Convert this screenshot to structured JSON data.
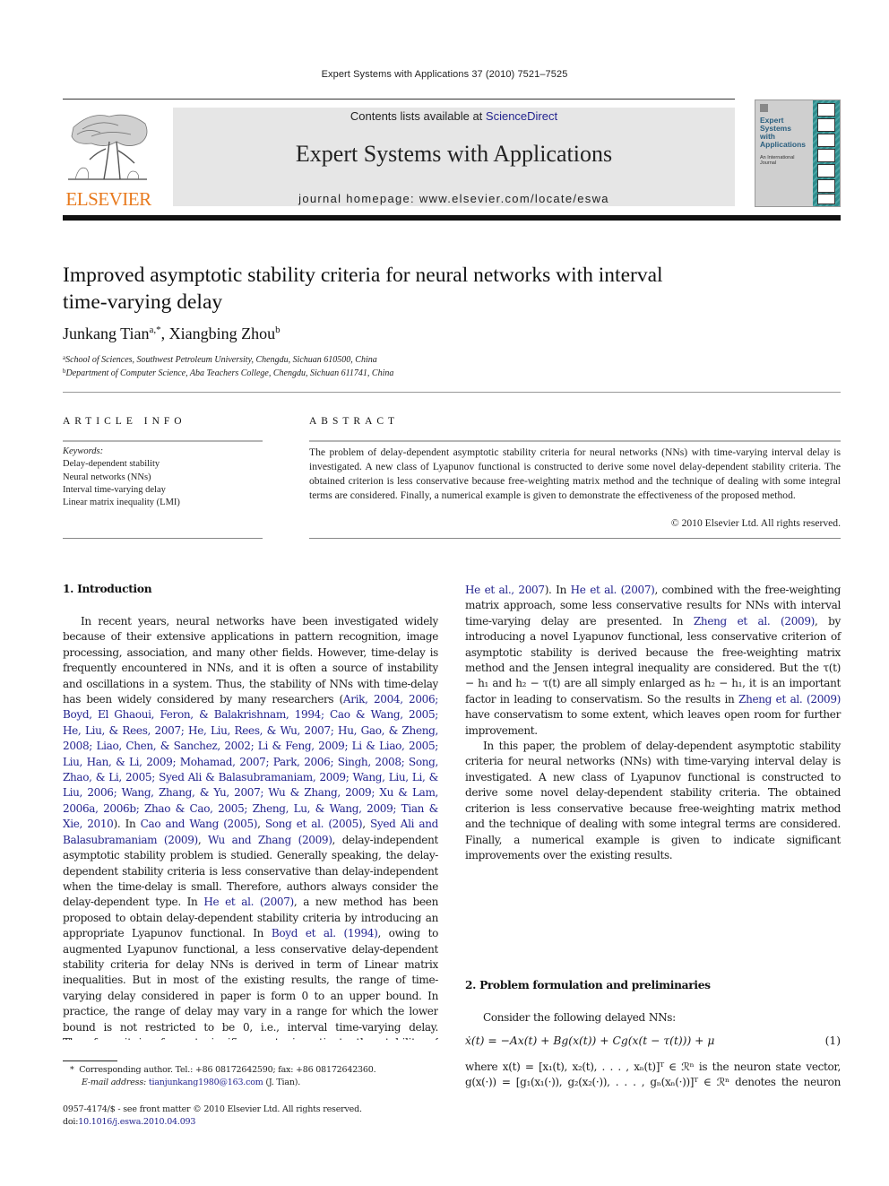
{
  "header": {
    "running_head": "Expert Systems with Applications 37 (2010) 7521–7525",
    "contents_prefix": "Contents lists available at ",
    "contents_link": "ScienceDirect",
    "journal_title": "Expert Systems with Applications",
    "homepage_prefix": "journal homepage: ",
    "homepage_url": "www.elsevier.com/locate/eswa",
    "publisher_name": "ELSEVIER",
    "cover_title_lines": [
      "Expert",
      "Systems",
      "with",
      "Applications"
    ],
    "cover_subtitle_lines": [
      "An International",
      "Journal"
    ]
  },
  "colors": {
    "link": "#24248f",
    "publisher_orange": "#e87a1e",
    "banner_gray": "#e6e6e6",
    "cover_teal": "#2f8b8b"
  },
  "article": {
    "title_line1": "Improved asymptotic stability criteria for neural networks with interval",
    "title_line2": "time-varying delay",
    "authors": [
      {
        "name": "Junkang Tian",
        "sup": "a,*"
      },
      {
        "name": "Xiangbing Zhou",
        "sup": "b"
      }
    ],
    "author_separator": ", ",
    "affiliations": [
      {
        "sup": "a",
        "text": "School of Sciences, Southwest Petroleum University, Chengdu, Sichuan 610500, China"
      },
      {
        "sup": "b",
        "text": "Department of Computer Science, Aba Teachers College, Chengdu, Sichuan 611741, China"
      }
    ]
  },
  "article_info": {
    "label": "ARTICLE INFO",
    "keywords_label": "Keywords:",
    "keywords": [
      "Delay-dependent stability",
      "Neural networks (NNs)",
      "Interval time-varying delay",
      "Linear matrix inequality (LMI)"
    ]
  },
  "abstract": {
    "label": "ABSTRACT",
    "text": "The problem of delay-dependent asymptotic stability criteria for neural networks (NNs) with time-varying interval delay is investigated. A new class of Lyapunov functional is constructed to derive some novel delay-dependent stability criteria. The obtained criterion is less conservative because free-weighting matrix method and the technique of dealing with some integral terms are considered. Finally, a numerical example is given to demonstrate the effectiveness of the proposed method.",
    "copyright": "© 2010 Elsevier Ltd. All rights reserved."
  },
  "section1": {
    "heading": "1. Introduction",
    "p1_a": "In recent years, neural networks have been investigated widely because of their extensive applications in pattern recognition, image processing, association, and many other fields. However, time-delay is frequently encountered in NNs, and it is often a source of instability and oscillations in a system. Thus, the stability of NNs with time-delay has been widely considered by many researchers (",
    "citations": "Arik, 2004, 2006; Boyd, El Ghaoui, Feron, & Balakrishnam, 1994; Cao & Wang, 2005; He, Liu, & Rees, 2007; He, Liu, Rees, & Wu, 2007; Hu, Gao, & Zheng, 2008; Liao, Chen, & Sanchez, 2002; Li & Feng, 2009; Li & Liao, 2005; Liu, Han, & Li, 2009; Mohamad, 2007; Park, 2006; Singh, 2008; Song, Zhao, & Li, 2005; Syed Ali & Balasubramaniam, 2009; Wang, Liu, Li, & Liu, 2006; Wang, Zhang, & Yu, 2007; Wu & Zhang, 2009; Xu & Lam, 2006a, 2006b; Zhao & Cao, 2005; Zheng, Lu, & Wang, 2009; Tian & Xie, 2010",
    "p1_b": "). In ",
    "cite_cao": "Cao and Wang (2005)",
    "comma1": ", ",
    "cite_song": "Song et al. (2005)",
    "comma2": ", ",
    "cite_syed": "Syed Ali and Balasubramaniam (2009)",
    "comma3": ", ",
    "cite_wu": "Wu and Zhang (2009)",
    "p1_c": ", delay-independent asymptotic stability problem is studied. Generally speaking, the delay-dependent stability criteria is less conservative than delay-independent when the time-delay is small. Therefore, authors always consider the delay-dependent type. In ",
    "cite_he1": "He et al. (2007)",
    "p1_d": ", a new method has been proposed to obtain delay-dependent stability criteria by introducing an appropriate Lyapunov functional. In ",
    "cite_boyd": "Boyd et al. (1994)",
    "p1_e": ", owing to augmented Lyapunov functional, a less conservative delay-dependent stability criteria for delay NNs is derived in term of Linear matrix inequalities. But in most of the existing results, the range of time-varying delay considered in paper is form 0 to an upper bound. In practice, the range of delay may vary in a range for which the lower bound is not restricted to be 0, i.e., interval time-varying delay. Therefore, it is of great significance to investigate the stability of system with interval time-varying delay, which has driven the initial study on NNs with interval time-varying delay (",
    "cite_he2": "He et al., 2007",
    "p1_f": "). In ",
    "cite_he3": "He et al. (2007)",
    "p1_g": ", combined with the free-weighting matrix approach, some less conservative results for NNs with interval time-varying delay are presented. In ",
    "cite_zheng1": "Zheng et al. (2009)",
    "p1_h": ", by introducing a novel Lyapunov functional, less conservative criterion of asymptotic stability is derived because the free-weighting matrix method and the Jensen integral inequality are considered. But the τ(t) − h₁ and h₂ − τ(t) are all simply enlarged as h₂ − h₁, it is an important factor in leading to conservatism. So the results in ",
    "cite_zheng2": "Zheng et al. (2009)",
    "p1_i": " have conservatism to some extent, which leaves open room for further improvement.",
    "p2": "In this paper, the problem of delay-dependent asymptotic stability criteria for neural networks (NNs) with time-varying interval delay is investigated. A new class of Lyapunov functional is constructed to derive some novel delay-dependent stability criteria. The obtained criterion is less conservative because free-weighting matrix method and the technique of dealing with some integral terms are considered. Finally, a numerical example is given to indicate significant improvements over the existing results."
  },
  "section2": {
    "heading": "2. Problem formulation and preliminaries",
    "intro": "Consider the following delayed NNs:",
    "equation": "ẋ(t) = −Ax(t) + Bg(x(t)) + Cg(x(t − τ(t))) + μ",
    "equation_number": "(1)",
    "where_line1": "where x(t) = [x₁(t), x₂(t), . . . , xₙ(t)]ᵀ ∈ ℛⁿ is the neuron state vector,",
    "where_line2": "g(x(·)) = [g₁(x₁(·)), g₂(x₂(·)), . . . , gₙ(xₙ(·))]ᵀ ∈ ℛⁿ denotes the neuron"
  },
  "footnotes": {
    "star": "*",
    "corresponding": "Corresponding author. Tel.: +86 08172642590; fax: +86 08172642360.",
    "email_label": "E-mail address: ",
    "email": "tianjunkang1980@163.com",
    "email_suffix": " (J. Tian).",
    "issn_line": "0957-4174/$ - see front matter © 2010 Elsevier Ltd. All rights reserved.",
    "doi_label": "doi:",
    "doi": "10.1016/j.eswa.2010.04.093"
  }
}
